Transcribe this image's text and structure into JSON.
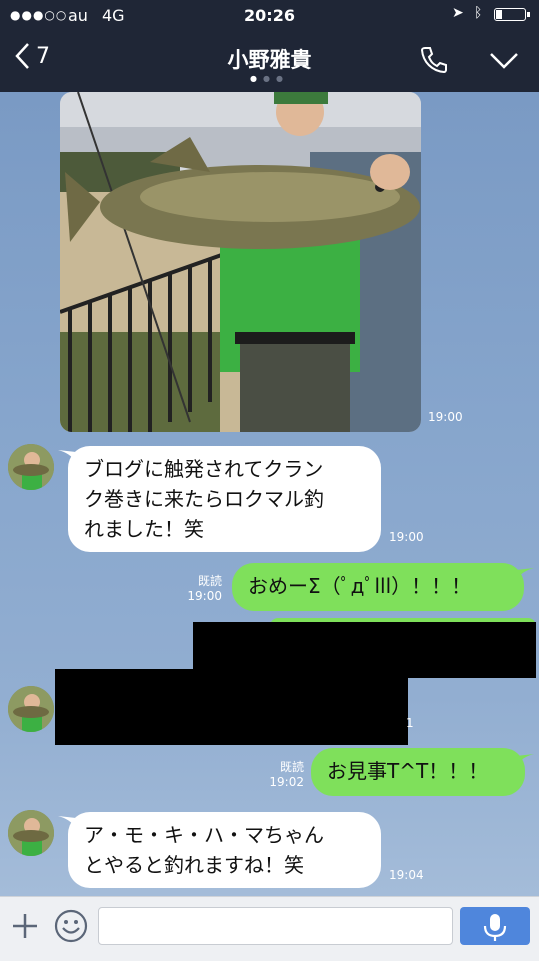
{
  "status_bar": {
    "signal": "●●●○○",
    "carrier": "au",
    "network": "4G",
    "time": "20:26"
  },
  "header": {
    "back_count": "7",
    "title": "小野雅貴",
    "page_dots": [
      "on",
      "off",
      "off"
    ]
  },
  "messages": [
    {
      "type": "image",
      "side": "in",
      "time": "19:00",
      "description": "fish-photo"
    },
    {
      "type": "text",
      "side": "in",
      "text_lines": [
        "ブログに触発されてクラン",
        "ク巻きに来たらロクマル釣",
        "れました！笑"
      ],
      "time": "19:00"
    },
    {
      "type": "text",
      "side": "out",
      "read": "既読",
      "time": "19:00",
      "text": "おめーΣ（ﾟдﾟlll）！！！"
    },
    {
      "type": "redacted",
      "side": "out"
    },
    {
      "type": "redacted",
      "side": "in",
      "time_fragment": "1"
    },
    {
      "type": "text",
      "side": "out",
      "read": "既読",
      "time": "19:02",
      "text": "お見事T^T！！！"
    },
    {
      "type": "text",
      "side": "in",
      "text_lines": [
        "ア・モ・キ・ハ・マちゃん",
        "とやると釣れますね！笑"
      ],
      "time": "19:04"
    }
  ],
  "input_bar": {
    "placeholder": ""
  },
  "colors": {
    "bar_bg": "#1f2636",
    "chat_bg": "#7b9bc4",
    "out_bubble": "#7fe05b",
    "in_bubble": "#ffffff",
    "mic_button": "#4f86dc"
  }
}
